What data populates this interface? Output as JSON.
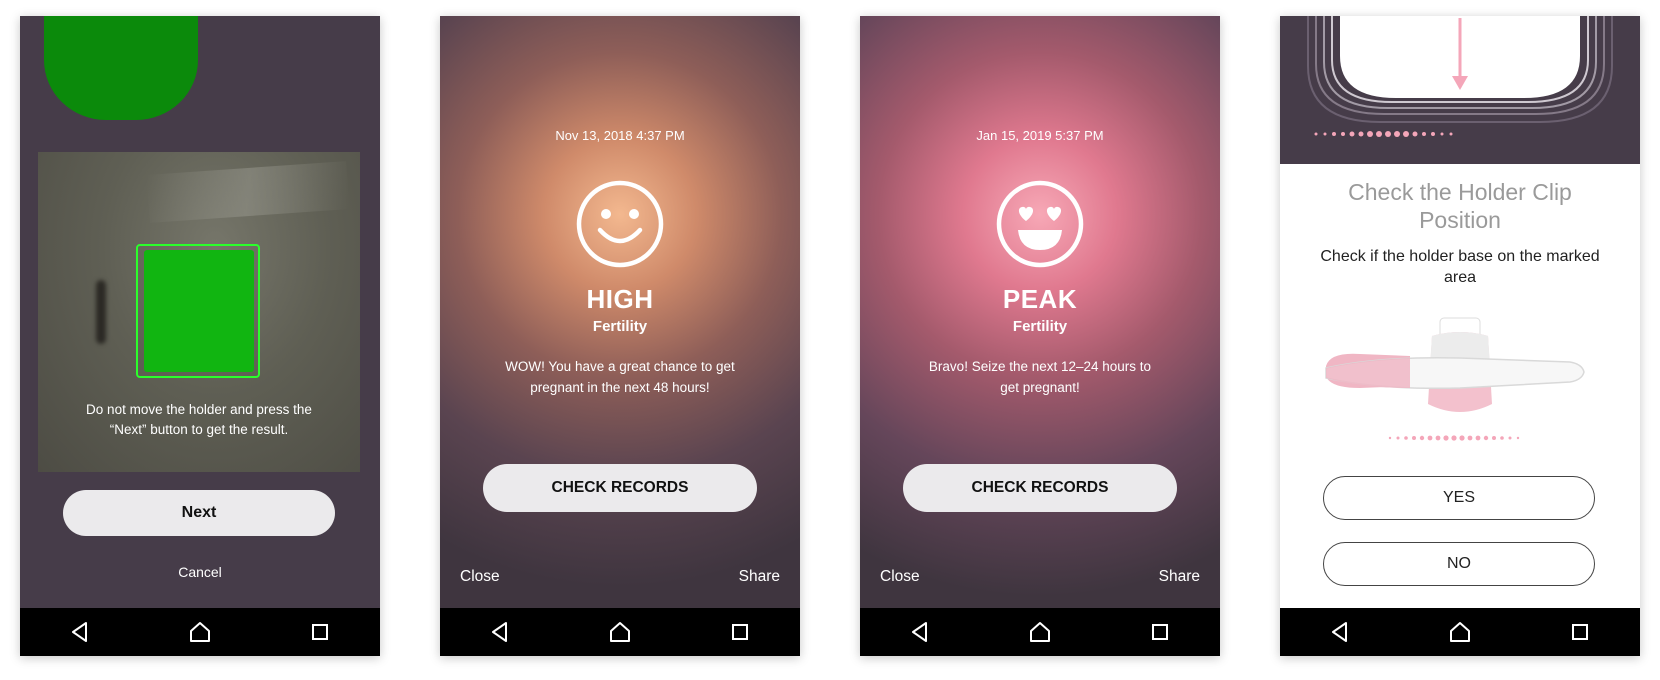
{
  "screens": [
    {
      "instruction": "Do not move the holder and press the “Next” button to get the result.",
      "next_label": "Next",
      "cancel_label": "Cancel"
    },
    {
      "date": "Nov 13, 2018 4:37 PM",
      "face_icon": "smiley-face-icon",
      "level": "HIGH",
      "level_sub": "Fertility",
      "message": "WOW! You have a great chance to get pregnant in the next 48 hours!",
      "check_records_label": "CHECK RECORDS",
      "close_label": "Close",
      "share_label": "Share",
      "glow_color": "#f3b88f"
    },
    {
      "date": "Jan 15, 2019 5:37 PM",
      "face_icon": "heart-eyes-face-icon",
      "level": "PEAK",
      "level_sub": "Fertility",
      "message": "Bravo! Seize the next 12–24 hours to get pregnant!",
      "check_records_label": "CHECK RECORDS",
      "close_label": "Close",
      "share_label": "Share",
      "glow_color": "#f7a8b6"
    },
    {
      "title": "Check the Holder Clip Position",
      "description": "Check if the holder base on the marked area",
      "yes_label": "YES",
      "no_label": "NO"
    }
  ],
  "colors": {
    "dark_background": "#463c49",
    "detection_green": "#2bff2b",
    "button_light": "#ebeaec",
    "accent_pink": "#f4a6b9"
  },
  "nav_icons": [
    "back-icon",
    "home-icon",
    "recents-icon"
  ]
}
